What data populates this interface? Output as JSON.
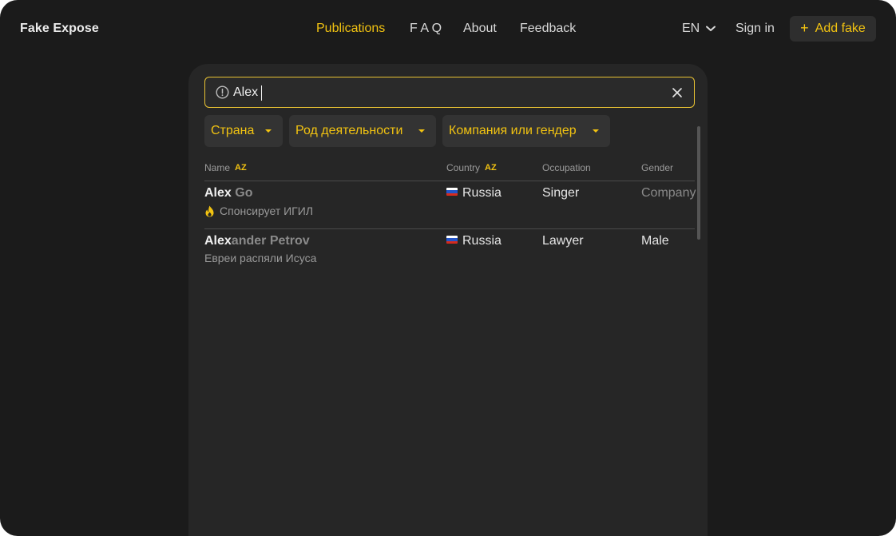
{
  "header": {
    "logo": "Fake Expose",
    "nav": [
      {
        "label": "Publications",
        "active": true
      },
      {
        "label": "F A Q",
        "active": false
      },
      {
        "label": "About",
        "active": false
      },
      {
        "label": "Feedback",
        "active": false
      }
    ],
    "language": "EN",
    "sign_in": "Sign in",
    "add_button": "Add fake",
    "add_button_icon": "+"
  },
  "search": {
    "value": "Alex",
    "icon": "info-circle-icon",
    "clear_icon": "close-icon"
  },
  "filters": [
    {
      "label": "Страна"
    },
    {
      "label": "Род деятельности"
    },
    {
      "label": "Компания или гендер"
    }
  ],
  "table": {
    "columns": [
      {
        "label": "Name",
        "sortable": true,
        "sort_icon": "AZ"
      },
      {
        "label": "Country",
        "sortable": true,
        "sort_icon": "AZ"
      },
      {
        "label": "Occupation",
        "sortable": false
      },
      {
        "label": "Gender",
        "sortable": false
      }
    ],
    "rows": [
      {
        "name_match": "Alex",
        "name_rest": " Go",
        "country": "Russia",
        "occupation": "Singer",
        "gender": "Company",
        "gender_muted": true,
        "subtitle": "Спонсирует ИГИЛ",
        "subtitle_icon": "fire-icon"
      },
      {
        "name_match": "Alex",
        "name_rest": "ander Petrov",
        "country": "Russia",
        "occupation": "Lawyer",
        "gender": "Male",
        "gender_muted": false,
        "subtitle": "Евреи распяли Исуса",
        "subtitle_icon": ""
      }
    ]
  },
  "colors": {
    "accent": "#f2c311",
    "background": "#1b1b1b",
    "panel": "#262626"
  }
}
